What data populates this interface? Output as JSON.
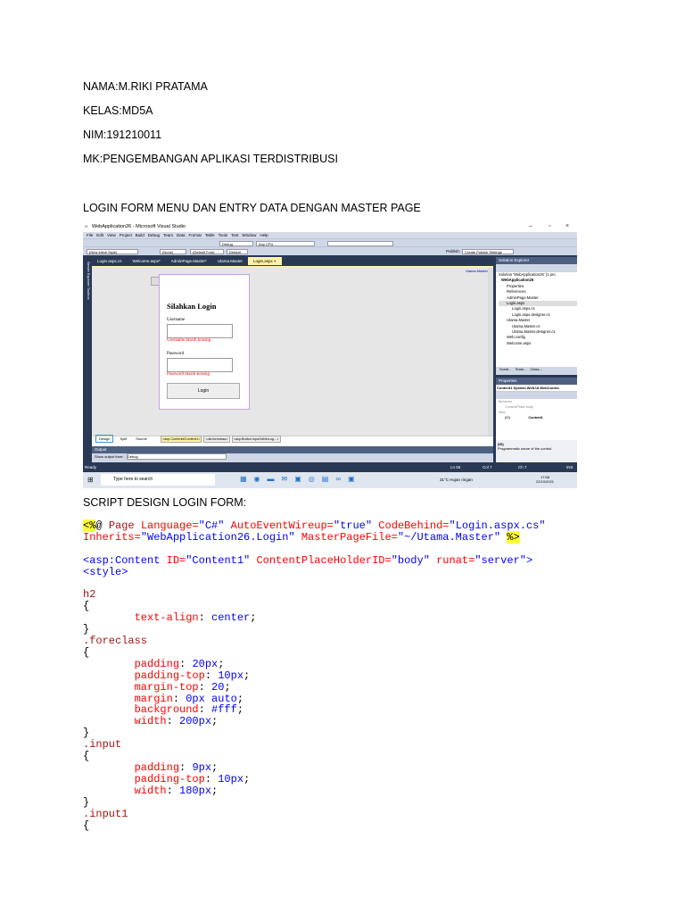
{
  "header": {
    "nama": "NAMA:M.RIKI PRATAMA",
    "kelas": "KELAS:MD5A",
    "nim": "NIM:191210011",
    "mk": "MK:PENGEMBANGAN APLIKASI TERDISTRIBUSI",
    "section1": "LOGIN FORM MENU DAN ENTRY DATA DENGAN MASTER PAGE",
    "section2": "SCRIPT DESIGN LOGIN FORM:"
  },
  "vs": {
    "title": "WebApplication26 - Microsoft Visual Studio",
    "menu": [
      "File",
      "Edit",
      "View",
      "Project",
      "Build",
      "Debug",
      "Team",
      "Data",
      "Format",
      "Table",
      "Tools",
      "Test",
      "Window",
      "Help"
    ],
    "toolbar": {
      "config": "Debug",
      "platform": "Any CPU",
      "style": "(New Inline Style)",
      "target": "(None)",
      "font": "(Default Font)",
      "size": "Default",
      "publish": "Publish:",
      "publish_setting": "Create Publish Settings"
    },
    "tabs": [
      "Login.aspx.cs",
      "Welcome.aspx*",
      "AdminPage.Master*",
      "Utama.Master",
      "Login.aspx ×"
    ],
    "master_link": "Utama.Master",
    "left_strip": "Server Explorer  Toolbox",
    "form": {
      "title": "Silahkan Login",
      "username_label": "Username",
      "username_error": "Username masih kosong",
      "password_label": "Password",
      "password_error": "Password masih kosong",
      "login_button": "Login"
    },
    "solution_explorer": {
      "title": "Solution Explorer",
      "items": [
        "Solution 'WebApplication26' (1 pro",
        "WebApplication26",
        "Properties",
        "References",
        "AdminPage.Master",
        "Login.aspx",
        "Login.aspx.cs",
        "Login.aspx.designer.cs",
        "Utama.Master",
        "Utama.Master.cs",
        "Utama.Master.designer.cs",
        "Web.config",
        "Welcome.aspx"
      ],
      "tabs": [
        "Soluti...",
        "Team...",
        "Class..."
      ]
    },
    "properties": {
      "title": "Properties",
      "object": "Content1 System.Web.UI.WebContro",
      "cat1": "Behavior",
      "row1": "ContentPlace body",
      "cat2": "Misc",
      "id_label": "(ID)",
      "id_value": "Content1",
      "desc_title": "(ID)",
      "desc": "Programmatic name of the control."
    },
    "view_tabs": [
      "Design",
      "Split",
      "Source"
    ],
    "breadcrumbs": [
      "<asp:Content#Content1>",
      "<div.foreclass>",
      "<asp:Button.input1#btnLog...>"
    ],
    "output": {
      "title": "Output",
      "show_from": "Show output from:",
      "source": "Debug"
    },
    "status": {
      "ready": "Ready",
      "ln": "Ln 55",
      "col": "Col 7",
      "ch": "Ch 7",
      "ins": "INS"
    },
    "taskbar": {
      "search": "Type here to search",
      "weather": "31°C  Hujan ringan",
      "time": "17:58",
      "date": "22/10/2021"
    }
  },
  "colors": {
    "attr": "#ff0000",
    "value": "#0000ff",
    "page": "#a31515",
    "black": "#000000",
    "hl": "#ffff33"
  },
  "code": [
    [
      [
        "<%",
        "hl"
      ],
      [
        "@ ",
        "black"
      ],
      [
        "Page ",
        "page"
      ],
      [
        "Language=",
        "attr"
      ],
      [
        "\"C#\" ",
        "value"
      ],
      [
        "AutoEventWireup=",
        "attr"
      ],
      [
        "\"true\" ",
        "value"
      ],
      [
        "CodeBehind=",
        "attr"
      ],
      [
        "\"Login.aspx.cs\"",
        "value"
      ]
    ],
    [
      [
        "Inherits=",
        "attr"
      ],
      [
        "\"WebApplication26.Login\" ",
        "value"
      ],
      [
        "MasterPageFile=",
        "attr"
      ],
      [
        "\"~/Utama.Master\" ",
        "value"
      ],
      [
        "%>",
        "hl"
      ]
    ],
    [],
    [
      [
        "<asp:Content ",
        "value"
      ],
      [
        "ID=",
        "attr"
      ],
      [
        "\"Content1\" ",
        "value"
      ],
      [
        "ContentPlaceHolderID=",
        "attr"
      ],
      [
        "\"body\" ",
        "value"
      ],
      [
        "runat=",
        "attr"
      ],
      [
        "\"server\">",
        "value"
      ]
    ],
    [
      [
        "<style>",
        "value"
      ]
    ],
    [],
    [
      [
        "h2",
        "page"
      ]
    ],
    [
      [
        "{",
        "black"
      ]
    ],
    [
      [
        "        text-align",
        "attr"
      ],
      [
        ": ",
        "black"
      ],
      [
        "center",
        "value"
      ],
      [
        ";",
        "black"
      ]
    ],
    [
      [
        "}",
        "black"
      ]
    ],
    [
      [
        ".foreclass",
        "page"
      ]
    ],
    [
      [
        "{",
        "black"
      ]
    ],
    [
      [
        "        padding",
        "attr"
      ],
      [
        ": ",
        "black"
      ],
      [
        "20px",
        "value"
      ],
      [
        ";",
        "black"
      ]
    ],
    [
      [
        "        padding-top",
        "attr"
      ],
      [
        ": ",
        "black"
      ],
      [
        "10px",
        "value"
      ],
      [
        ";",
        "black"
      ]
    ],
    [
      [
        "        margin-top",
        "attr"
      ],
      [
        ": ",
        "black"
      ],
      [
        "20",
        "value"
      ],
      [
        ";",
        "black"
      ]
    ],
    [
      [
        "        margin",
        "attr"
      ],
      [
        ": ",
        "black"
      ],
      [
        "0px auto",
        "value"
      ],
      [
        ";",
        "black"
      ]
    ],
    [
      [
        "        background",
        "attr"
      ],
      [
        ": ",
        "black"
      ],
      [
        "#fff",
        "value"
      ],
      [
        ";",
        "black"
      ]
    ],
    [
      [
        "        width",
        "attr"
      ],
      [
        ": ",
        "black"
      ],
      [
        "200px",
        "value"
      ],
      [
        ";",
        "black"
      ]
    ],
    [
      [
        "}",
        "black"
      ]
    ],
    [
      [
        ".input",
        "page"
      ]
    ],
    [
      [
        "{",
        "black"
      ]
    ],
    [
      [
        "        padding",
        "attr"
      ],
      [
        ": ",
        "black"
      ],
      [
        "9px",
        "value"
      ],
      [
        ";",
        "black"
      ]
    ],
    [
      [
        "        padding-top",
        "attr"
      ],
      [
        ": ",
        "black"
      ],
      [
        "10px",
        "value"
      ],
      [
        ";",
        "black"
      ]
    ],
    [
      [
        "        width",
        "attr"
      ],
      [
        ": ",
        "black"
      ],
      [
        "180px",
        "value"
      ],
      [
        ";",
        "black"
      ]
    ],
    [
      [
        "}",
        "black"
      ]
    ],
    [
      [
        ".input1",
        "page"
      ]
    ],
    [
      [
        "{",
        "black"
      ]
    ]
  ]
}
